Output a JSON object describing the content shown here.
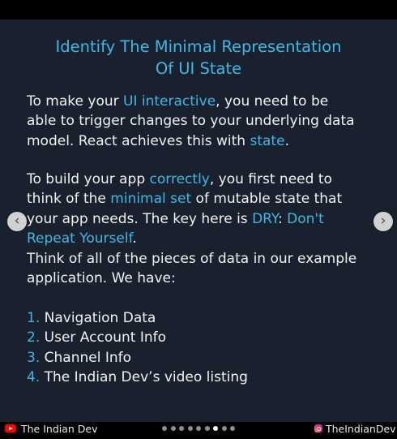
{
  "slide": {
    "title_line1": "Identify The Minimal Representation",
    "title_line2": "Of UI State",
    "paragraph1": {
      "line1_a": "To make your ",
      "line1_hl": "UI interactive",
      "line1_b": ", you need to be",
      "line2": "able to trigger changes to your underlying data",
      "line3_a": "model. React achieves this with ",
      "line3_hl": "state",
      "line3_b": "."
    },
    "paragraph2": {
      "line1_a": "To build your app ",
      "line1_hl": "correctly",
      "line1_b": ", you first need to",
      "line2_a": "think of the ",
      "line2_hl": "minimal set",
      "line2_b": " of mutable state that",
      "line3_a": "your app needs. The key here is ",
      "line3_hl1": "DRY",
      "line3_b": ": ",
      "line3_hl2": "Don't",
      "line4_hl": "Repeat Yourself",
      "line4_b": "."
    },
    "paragraph3": {
      "line1": "Think of all of the pieces of data in our example",
      "line2": "application. We have:"
    },
    "list": [
      {
        "num": "1.",
        "text": " Navigation Data"
      },
      {
        "num": "2.",
        "text": " User Account Info"
      },
      {
        "num": "3.",
        "text": " Channel Info"
      },
      {
        "num": "4.",
        "text": " The Indian Dev’s video listing"
      }
    ]
  },
  "footer": {
    "left_brand": "The Indian Dev",
    "right_brand": "TheIndianDev",
    "dots_total": 9,
    "dots_active_index": 6
  },
  "nav": {
    "prev_glyph": "‹",
    "next_glyph": "›"
  },
  "colors": {
    "background": "#19212e",
    "accent": "#3fb8e6",
    "text": "#f2f2f2"
  },
  "icons": {
    "left_brand": "youtube-icon",
    "right_brand": "instagram-icon"
  }
}
